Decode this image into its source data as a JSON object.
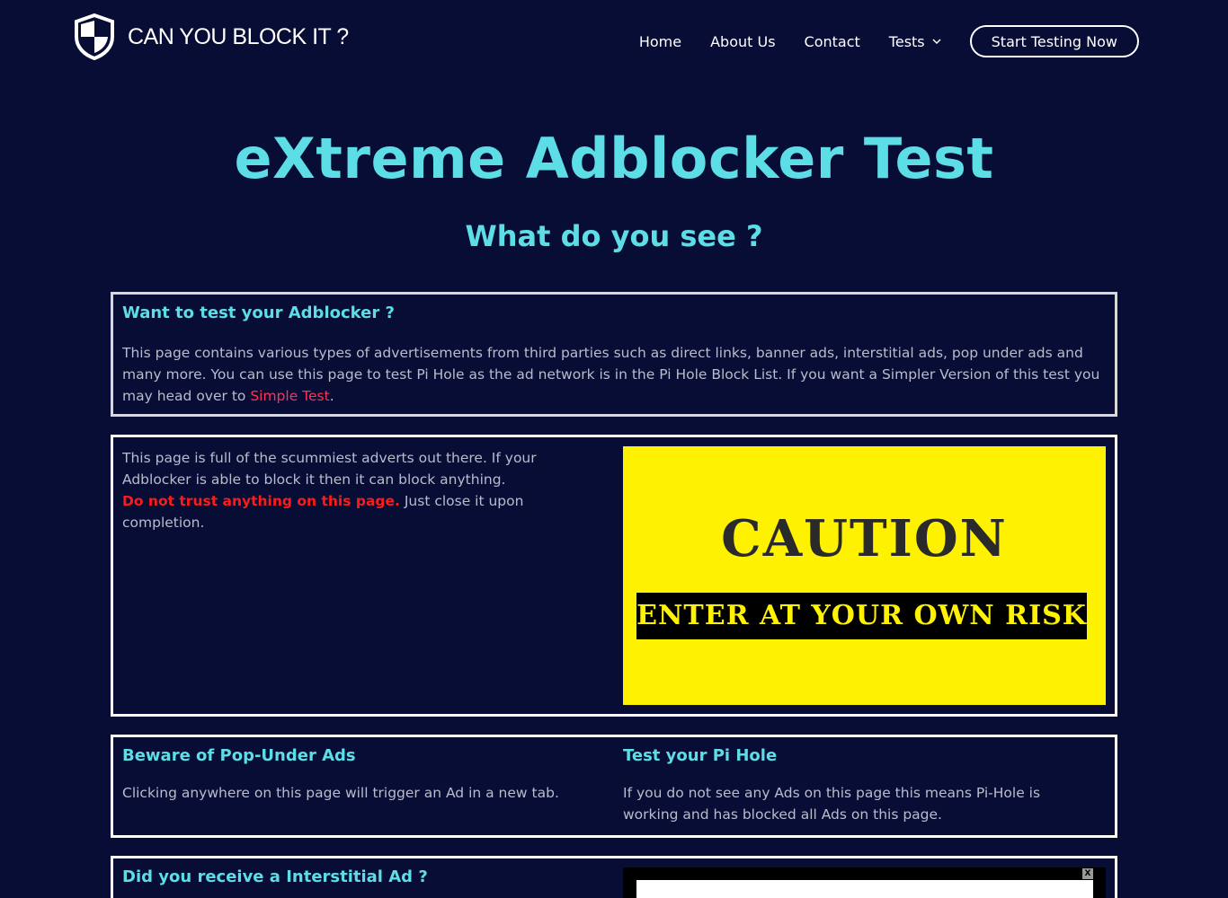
{
  "header": {
    "logo_text": "CAN YOU BLOCK IT ?",
    "nav": [
      "Home",
      "About Us",
      "Contact",
      "Tests"
    ],
    "cta": "Start Testing Now"
  },
  "hero": {
    "title": "eXtreme Adblocker Test",
    "subtitle": "What do you see ?"
  },
  "intro": {
    "heading": "Want to test your Adblocker ?",
    "text": "This page contains various types of advertisements from third parties such as direct links, banner ads, interstitial ads, pop under ads and many more. You can use this page to test Pi Hole as the ad network is in the Pi Hole Block List. If you want a Simpler Version of this test you may head over to ",
    "link": "Simple Test",
    "text_end": "."
  },
  "warning": {
    "text": "This page is full of the scummiest adverts out there. If your Adblocker is able to block it then it can block anything.",
    "alert": "Do not trust anything on this page.",
    "text_end": " Just close it upon completion.",
    "banner_title": "CAUTION",
    "banner_band": "ENTER AT YOUR OWN RISK"
  },
  "info": {
    "left_heading": "Beware of Pop-Under Ads",
    "left_text": "Clicking anywhere on this page will trigger an Ad in a new tab.",
    "right_heading": "Test your Pi Hole",
    "right_text": "If you do not see any Ads on this page this means Pi-Hole is working and has blocked all Ads on this page."
  },
  "interstitial": {
    "heading": "Did you receive a Interstitial Ad ?",
    "close": "X"
  },
  "colors": {
    "background": "#070d35",
    "accent": "#5ddde6",
    "link": "#ff3355",
    "warning": "#ff1a1a",
    "caution_yellow": "#fff200"
  }
}
